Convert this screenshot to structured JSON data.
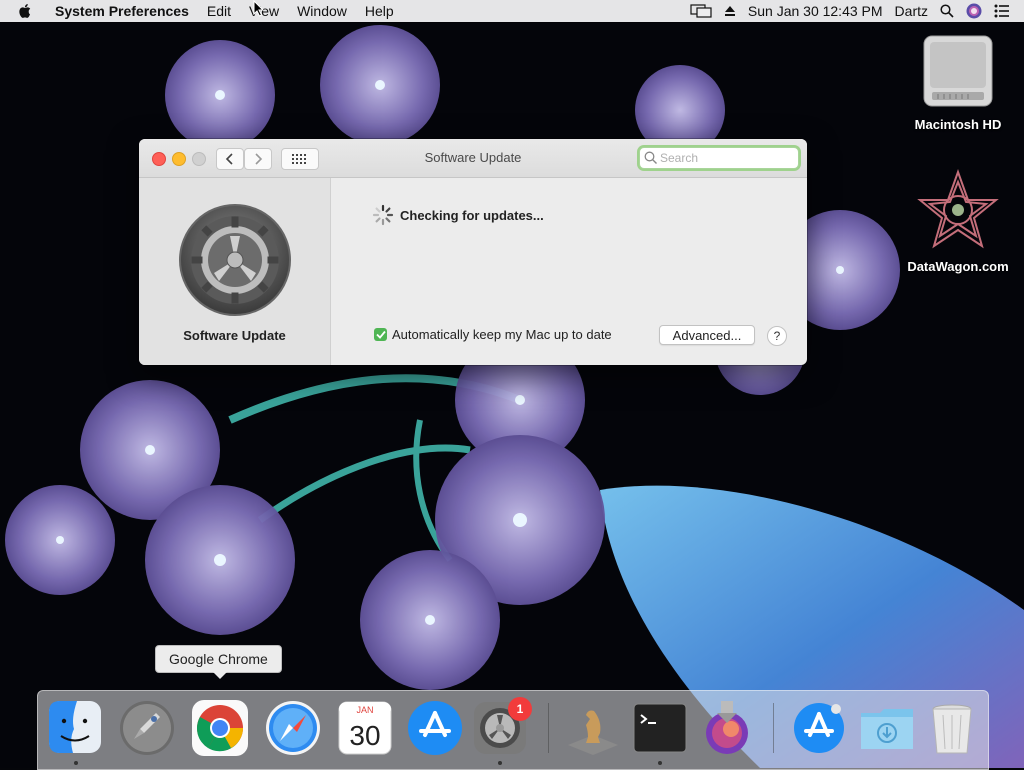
{
  "menubar": {
    "app_name": "System Preferences",
    "menus": [
      "Edit",
      "View",
      "Window",
      "Help"
    ],
    "datetime": "Sun Jan 30  12:43 PM",
    "user": "Dartz"
  },
  "desktop": {
    "icons": [
      {
        "label": "Macintosh HD",
        "icon": "hard-drive-icon"
      },
      {
        "label": "DataWagon.com",
        "icon": "datawagon-logo-icon"
      }
    ]
  },
  "window": {
    "title": "Software Update",
    "search_placeholder": "Search",
    "sidebar_label": "Software Update",
    "status_text": "Checking for updates...",
    "auto_update_label": "Automatically keep my Mac up to date",
    "auto_update_checked": true,
    "advanced_label": "Advanced...",
    "help_label": "?"
  },
  "tooltip": {
    "text": "Google Chrome"
  },
  "dock": {
    "items": [
      {
        "name": "Finder",
        "icon": "finder-icon",
        "running": true
      },
      {
        "name": "Launchpad",
        "icon": "launchpad-icon",
        "running": false
      },
      {
        "name": "Google Chrome",
        "icon": "chrome-icon",
        "running": false
      },
      {
        "name": "Safari",
        "icon": "safari-icon",
        "running": false
      },
      {
        "name": "Calendar",
        "icon": "calendar-icon",
        "running": false,
        "month": "JAN",
        "day": "30"
      },
      {
        "name": "App Store",
        "icon": "app-store-icon",
        "running": false
      },
      {
        "name": "System Preferences",
        "icon": "system-preferences-icon",
        "running": true,
        "badge": "1"
      },
      {
        "name": "Chess",
        "icon": "chess-icon",
        "running": false
      },
      {
        "name": "Terminal",
        "icon": "terminal-icon",
        "running": true
      },
      {
        "name": "macOS Monterey",
        "icon": "installer-icon",
        "running": false
      },
      {
        "name": "App Store Installer",
        "icon": "app-store-icon-2",
        "running": false
      },
      {
        "name": "Downloads",
        "icon": "downloads-folder-icon",
        "running": false
      },
      {
        "name": "Trash",
        "icon": "trash-icon",
        "running": false
      }
    ]
  },
  "colors": {
    "close": "#fe5f57",
    "minimize": "#febc2e",
    "check_green": "#4fb554",
    "badge_red": "#f23b3b"
  }
}
